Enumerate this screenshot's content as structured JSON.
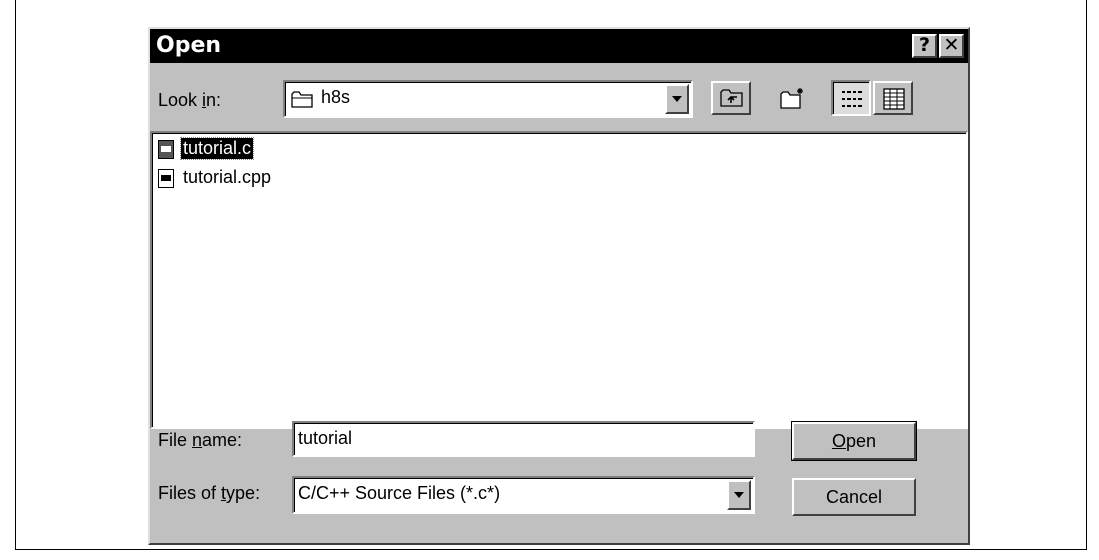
{
  "window": {
    "title": "Open",
    "help_label": "?",
    "close_label": "✕"
  },
  "look_in": {
    "label_prefix": "Look ",
    "label_accel": "i",
    "label_suffix": "n:",
    "value": "h8s",
    "value_icon": "folder-icon"
  },
  "toolbar": {
    "up_folder_icon": "up-folder-icon",
    "new_folder_icon": "new-folder-icon",
    "list_view_icon": "list-view-icon",
    "details_view_icon": "details-view-icon"
  },
  "files": [
    {
      "name": "tutorial.c",
      "selected": true,
      "icon": "c-file-icon"
    },
    {
      "name": "tutorial.cpp",
      "selected": false,
      "icon": "cpp-file-icon"
    }
  ],
  "file_name": {
    "label_prefix": "File ",
    "label_accel": "n",
    "label_suffix": "ame:",
    "value": "tutorial"
  },
  "file_type": {
    "label_prefix": "Files of ",
    "label_accel": "t",
    "label_suffix": "ype:",
    "value": "C/C++ Source Files (*.c*)"
  },
  "buttons": {
    "open_accel": "O",
    "open_rest": "pen",
    "cancel": "Cancel"
  }
}
